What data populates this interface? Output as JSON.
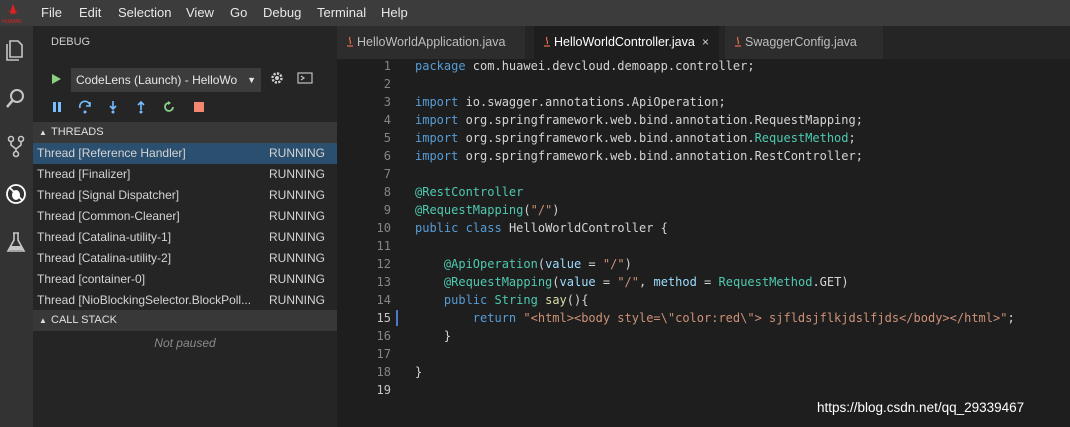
{
  "menu": [
    "File",
    "Edit",
    "Selection",
    "View",
    "Go",
    "Debug",
    "Terminal",
    "Help"
  ],
  "logo_text": "HUAWEI",
  "activity_icons": [
    "explorer-icon",
    "search-icon",
    "source-control-icon",
    "debug-icon",
    "test-icon"
  ],
  "sidebar": {
    "title": "DEBUG",
    "launch_config": "CodeLens (Launch) - HelloWo",
    "threads_header": "THREADS",
    "threads": [
      {
        "name": "Thread [Reference Handler]",
        "state": "RUNNING",
        "selected": true
      },
      {
        "name": "Thread [Finalizer]",
        "state": "RUNNING"
      },
      {
        "name": "Thread [Signal Dispatcher]",
        "state": "RUNNING"
      },
      {
        "name": "Thread [Common-Cleaner]",
        "state": "RUNNING"
      },
      {
        "name": "Thread [Catalina-utility-1]",
        "state": "RUNNING"
      },
      {
        "name": "Thread [Catalina-utility-2]",
        "state": "RUNNING"
      },
      {
        "name": "Thread [container-0]",
        "state": "RUNNING"
      },
      {
        "name": "Thread [NioBlockingSelector.BlockPoll...",
        "state": "RUNNING"
      }
    ],
    "callstack_header": "CALL STACK",
    "callstack_status": "Not paused"
  },
  "tabs": [
    {
      "label": "HelloWorldApplication.java",
      "active": false
    },
    {
      "label": "HelloWorldController.java",
      "active": true,
      "close": "×"
    },
    {
      "label": "SwaggerConfig.java",
      "active": false
    }
  ],
  "editor": {
    "current_line": 15,
    "lines": [
      "package com.huawei.devcloud.demoapp.controller;",
      "",
      "import io.swagger.annotations.ApiOperation;",
      "import org.springframework.web.bind.annotation.RequestMapping;",
      "import org.springframework.web.bind.annotation.RequestMethod;",
      "import org.springframework.web.bind.annotation.RestController;",
      "",
      "@RestController",
      "@RequestMapping(\"/\")",
      "public class HelloWorldController {",
      "",
      "    @ApiOperation(value = \"/\")",
      "    @RequestMapping(value = \"/\", method = RequestMethod.GET)",
      "    public String say(){",
      "        return \"<html><body style=\\\"color:red\\\"> sjfldsjflkjdslfjds</body></html>\";",
      "    }",
      "",
      "}",
      ""
    ]
  },
  "watermark": "https://blog.csdn.net/qq_29339467",
  "colors": {
    "running_state": "#d4d4d4",
    "selected_row": "#2b4f6f",
    "run_green": "#89d185",
    "stop_red": "#f48771"
  }
}
